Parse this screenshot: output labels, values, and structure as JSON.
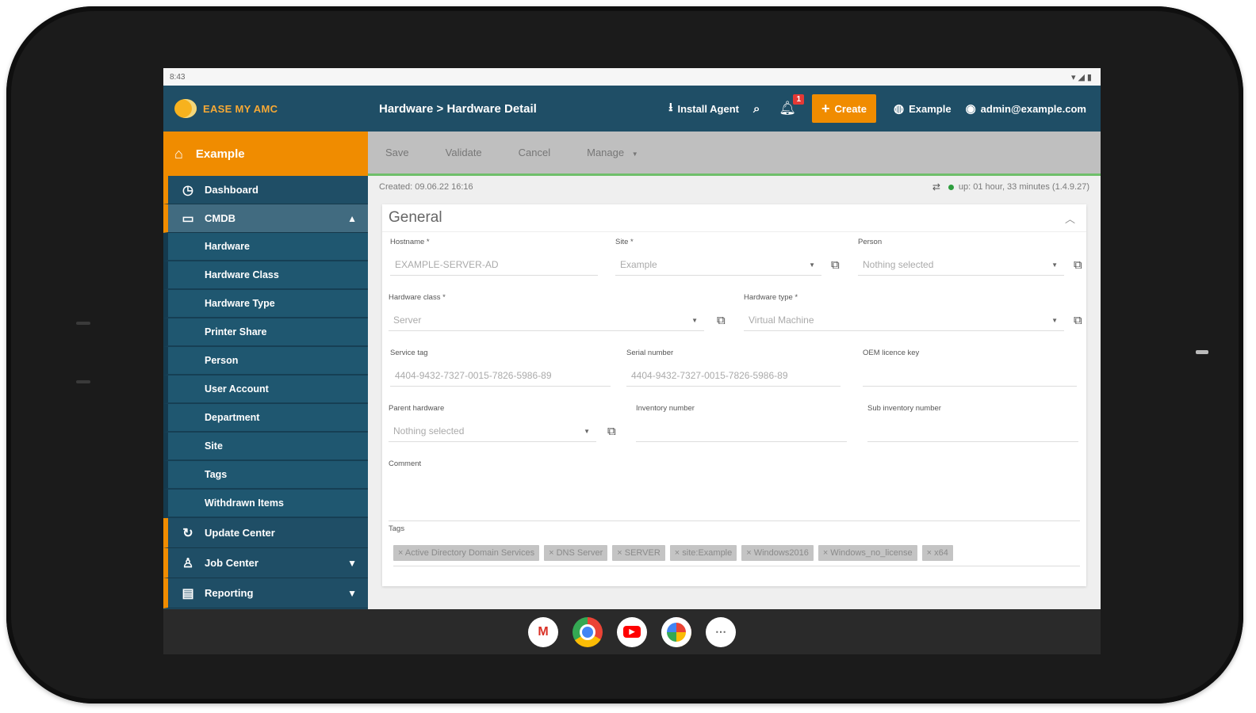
{
  "statusbar": {
    "time": "8:43",
    "icons": "▾◢▮"
  },
  "topbar": {
    "logo_text": "EASE MY AMC",
    "breadcrumb": "Hardware > Hardware Detail",
    "install_agent": "Install Agent",
    "notification_count": "1",
    "create_label": "Create",
    "site_label": "Example",
    "user_label": "admin@example.com"
  },
  "sidebar": {
    "home_label": "Example",
    "dashboard_label": "Dashboard",
    "cmdb_label": "CMDB",
    "cmdb_items": [
      "Hardware",
      "Hardware Class",
      "Hardware Type",
      "Printer Share",
      "Person",
      "User Account",
      "Department",
      "Site",
      "Tags",
      "Withdrawn Items"
    ],
    "update_center_label": "Update Center",
    "job_center_label": "Job Center",
    "reporting_label": "Reporting"
  },
  "actions": {
    "save": "Save",
    "validate": "Validate",
    "cancel": "Cancel",
    "manage": "Manage"
  },
  "meta": {
    "created": "Created: 09.06.22 16:16",
    "uptime": "up: 01 hour, 33 minutes (1.4.9.27)"
  },
  "form": {
    "section_title": "General",
    "hostname": {
      "label": "Hostname *",
      "value": "EXAMPLE-SERVER-AD"
    },
    "site": {
      "label": "Site *",
      "value": "Example"
    },
    "person": {
      "label": "Person",
      "value": "Nothing selected"
    },
    "hardware_class": {
      "label": "Hardware class *",
      "value": "Server"
    },
    "hardware_type": {
      "label": "Hardware type *",
      "value": "Virtual Machine"
    },
    "service_tag": {
      "label": "Service tag",
      "value": "4404-9432-7327-0015-7826-5986-89"
    },
    "serial_number": {
      "label": "Serial number",
      "value": "4404-9432-7327-0015-7826-5986-89"
    },
    "oem_license": {
      "label": "OEM licence key",
      "value": ""
    },
    "parent_hardware": {
      "label": "Parent hardware",
      "value": "Nothing selected"
    },
    "inventory_number": {
      "label": "Inventory number",
      "value": ""
    },
    "sub_inventory_number": {
      "label": "Sub inventory number",
      "value": ""
    },
    "comment": {
      "label": "Comment",
      "value": ""
    },
    "tags_label": "Tags",
    "tags": [
      "× Active Directory Domain Services",
      "× DNS Server",
      "× SERVER",
      "× site:Example",
      "× Windows2016",
      "× Windows_no_license",
      "× x64"
    ]
  },
  "dock": {
    "apps": [
      "gmail-icon",
      "chrome-icon",
      "youtube-icon",
      "photos-icon",
      "app-drawer-icon"
    ]
  },
  "colors": {
    "topbar": "#1f4e66",
    "accent": "#f08c00",
    "sidebar_active": "#416b80",
    "status_green": "#2e9e3e"
  }
}
